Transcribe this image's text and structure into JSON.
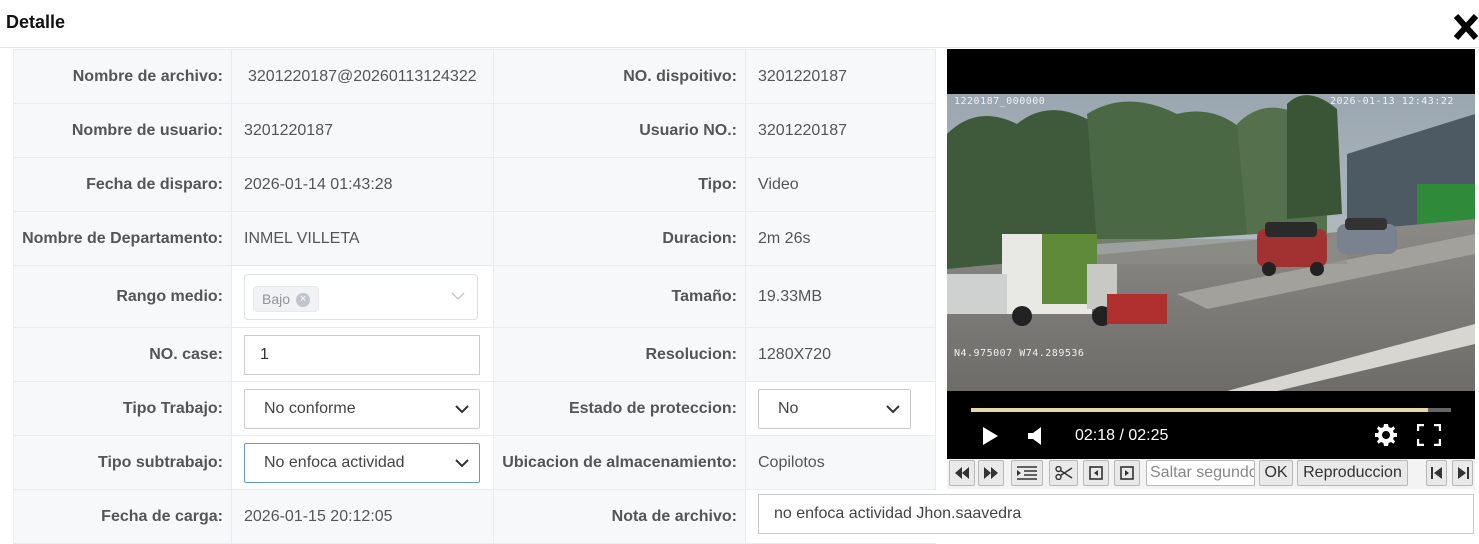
{
  "dialog": {
    "title": "Detalle"
  },
  "fields": {
    "nombre_archivo": {
      "label": "Nombre de archivo:",
      "value": "3201220187@20260113124322"
    },
    "no_dispositivo": {
      "label": "NO. dispoitivo:",
      "value": "3201220187"
    },
    "nombre_usuario": {
      "label": "Nombre de usuario:",
      "value": "3201220187"
    },
    "usuario_no": {
      "label": "Usuario NO.:",
      "value": "3201220187"
    },
    "fecha_disparo": {
      "label": "Fecha de disparo:",
      "value": "2026-01-14 01:43:28"
    },
    "tipo": {
      "label": "Tipo:",
      "value": "Video"
    },
    "nombre_departamento": {
      "label": "Nombre de Departamento:",
      "value": "INMEL VILLETA"
    },
    "duracion": {
      "label": "Duracion:",
      "value": "2m 26s"
    },
    "rango_medio": {
      "label": "Rango medio:",
      "tag": "Bajo"
    },
    "tamano": {
      "label": "Tamaño:",
      "value": "19.33MB"
    },
    "no_case": {
      "label": "NO. case:",
      "value": "1"
    },
    "resolucion": {
      "label": "Resolucion:",
      "value": "1280X720"
    },
    "tipo_trabajo": {
      "label": "Tipo Trabajo:",
      "value": "No conforme"
    },
    "estado_proteccion": {
      "label": "Estado de proteccion:",
      "value": "No"
    },
    "tipo_subtrabajo": {
      "label": "Tipo subtrabajo:",
      "value": "No enfoca actividad"
    },
    "ubicacion": {
      "label": "Ubicacion de almacenamiento:",
      "value": "Copilotos"
    },
    "fecha_carga": {
      "label": "Fecha de carga:",
      "value": "2026-01-15 20:12:05"
    },
    "nota_archivo": {
      "label": "Nota de archivo:",
      "value": "no enfoca actividad Jhon.saavedra"
    }
  },
  "player": {
    "overlay_top_left": "1220187_000000",
    "overlay_top_right": "2026-01-13 12:43:22",
    "overlay_bottom_left": "N4.975007 W74.289536",
    "time_display": "02:18 / 02:25",
    "progress_fraction": 0.952,
    "colors": {
      "progress_fill": "#e6d8a8",
      "progress_track": "#666666",
      "background": "#000000"
    }
  },
  "toolbar": {
    "seek_placeholder": "Saltar segundos",
    "ok_label": "OK",
    "playback_label": "Reproduccion"
  },
  "icons": {
    "close": "close-icon",
    "play": "play-icon",
    "volume": "volume-icon",
    "settings": "gear-icon",
    "fullscreen": "fullscreen-icon",
    "rewind": "rewind-icon",
    "forward": "fast-forward-icon",
    "list": "list-icon",
    "cut": "scissors-icon",
    "prev_frame": "frame-back-icon",
    "next_frame": "frame-forward-icon",
    "first": "skip-first-icon",
    "last": "skip-last-icon"
  }
}
